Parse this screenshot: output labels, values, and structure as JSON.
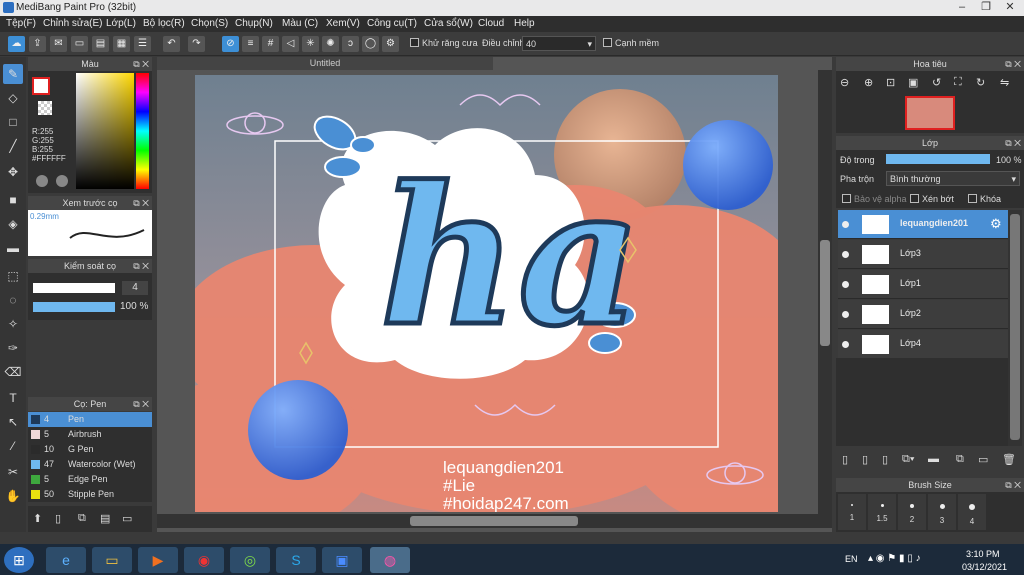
{
  "window": {
    "title": "MediBang Paint Pro (32bit)",
    "min": "‒",
    "max": "❐",
    "close": "✕"
  },
  "menu": [
    "Tệp(F)",
    "Chỉnh sửa(E)",
    "Lớp(L)",
    "Bộ lọc(R)",
    "Chọn(S)",
    "Chụp(N)",
    "Màu (C)",
    "Xem(V)",
    "Công cụ(T)",
    "Cửa sổ(W)",
    "Cloud",
    "Help"
  ],
  "toolbar": {
    "antialias_label": "Khử răng cưa",
    "adjust_label": "Điều chỉnh",
    "adjust_value": "40",
    "sharp_label": "Cạnh mềm"
  },
  "colorPanel": {
    "title": "Màu",
    "rgb": [
      "R:255",
      "G:255",
      "B:255"
    ],
    "hex": "#FFFFFF"
  },
  "brushPreview": {
    "title": "Xem trước cọ",
    "size": "0.29mm"
  },
  "brushControl": {
    "title": "Kiểm soát cọ",
    "size_value": "4",
    "opacity_value": "100 %"
  },
  "brushList": {
    "title": "Cọ: Pen",
    "items": [
      {
        "size": "4",
        "name": "Pen",
        "color": "#1e3a5a",
        "selected": true
      },
      {
        "size": "5",
        "name": "Airbrush",
        "color": "#f0d8d8",
        "selected": false
      },
      {
        "size": "10",
        "name": "G Pen",
        "color": "#2b2b2b",
        "selected": false
      },
      {
        "size": "47",
        "name": "Watercolor (Wet)",
        "color": "#6fb8ef",
        "selected": false
      },
      {
        "size": "5",
        "name": "Edge Pen",
        "color": "#3ea83e",
        "selected": false
      },
      {
        "size": "50",
        "name": "Stipple Pen",
        "color": "#e8e010",
        "selected": false
      }
    ]
  },
  "document": {
    "tab": "Untitled"
  },
  "artwork": {
    "title_text": "ha",
    "watermark": [
      "lequangdien201",
      "#Lie",
      "#hoidap247.com"
    ]
  },
  "navigator": {
    "title": "Hoa tiêu"
  },
  "layers": {
    "title": "Lớp",
    "opacity_label": "Độ trong",
    "opacity_value": "100 %",
    "blend_label": "Pha trộn",
    "blend_value": "Bình thường",
    "protect_alpha": "Bảo vệ alpha",
    "clipping": "Xén bớt",
    "lock": "Khóa",
    "items": [
      {
        "name": "lequangdien201",
        "selected": true
      },
      {
        "name": "Lớp3",
        "selected": false
      },
      {
        "name": "Lớp1",
        "selected": false
      },
      {
        "name": "Lớp2",
        "selected": false
      },
      {
        "name": "Lớp4",
        "selected": false
      }
    ]
  },
  "brushSize": {
    "title": "Brush Size",
    "sizes": [
      "1",
      "1.5",
      "2",
      "3",
      "4"
    ]
  },
  "taskbar": {
    "lang": "EN",
    "time": "3:10 PM",
    "date": "03/12/2021"
  },
  "colors": {
    "accent": "#4a8fd4",
    "panel": "#2f2f2f",
    "sky": "#7f8ea0",
    "cloud": "#e98670"
  }
}
